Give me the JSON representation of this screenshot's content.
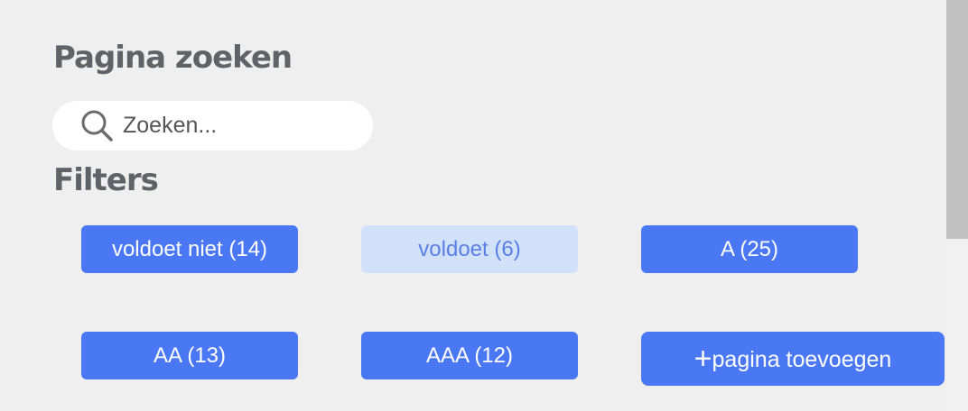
{
  "search_section": {
    "title": "Pagina zoeken",
    "search_placeholder": "Zoeken...",
    "search_value": "",
    "search_icon": "magnifier-icon"
  },
  "filters_section": {
    "title": "Filters",
    "chips": [
      {
        "label": "voldoet niet (14)",
        "active": true
      },
      {
        "label": "voldoet (6)",
        "active": false
      },
      {
        "label": "A (25)",
        "active": true
      },
      {
        "label": "AA (13)",
        "active": true
      },
      {
        "label": "AAA (12)",
        "active": true
      }
    ],
    "add_page_button": {
      "icon": "+",
      "label": "pagina toevoegen"
    }
  },
  "colors": {
    "accent": "#4a78f5",
    "inactive_chip_bg": "#d1e1fa",
    "inactive_chip_text": "#5a80e6",
    "heading": "#5f6368",
    "background": "#efefef"
  }
}
